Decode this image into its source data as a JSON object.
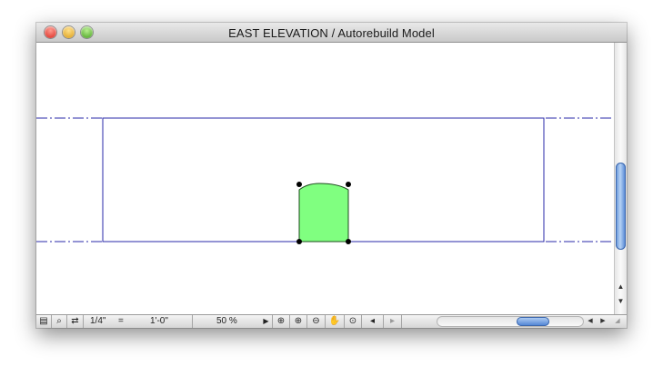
{
  "window": {
    "title": "EAST ELEVATION / Autorebuild Model"
  },
  "colors": {
    "line": "#2a2aa8",
    "shape_fill": "#80ff80",
    "shape_stroke": "#1d4a1d"
  },
  "statusbar": {
    "scale": "1/4\"",
    "equals": "=",
    "scale_value": "1'-0\"",
    "zoom": "50 %"
  },
  "icons": [
    "layer-settings-icon",
    "preview-icon",
    "navigate-icon",
    "play-arrow-icon",
    "zoom-fit-icon",
    "zoom-in-icon",
    "zoom-out-icon",
    "pan-hand-icon",
    "zoom-previous-icon",
    "zoom-back-icon",
    "zoom-forward-icon"
  ]
}
